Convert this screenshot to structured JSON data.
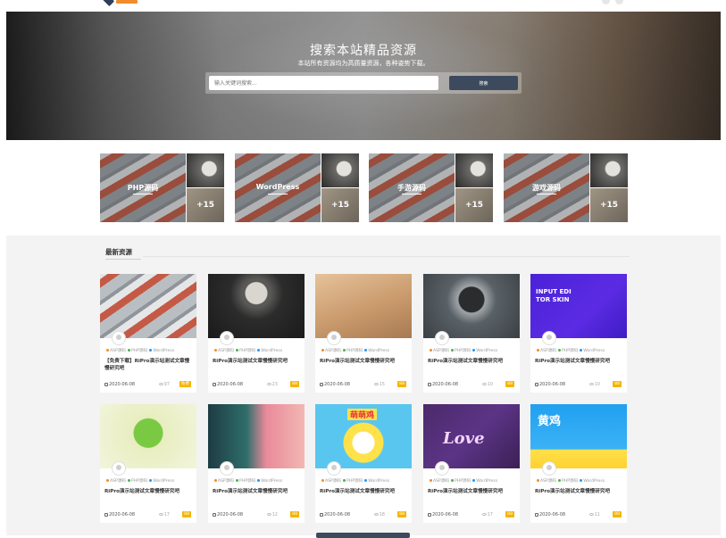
{
  "hero": {
    "title": "搜索本站精品资源",
    "subtitle": "本站所有资源均为高质量资源，各种姿势下载。",
    "search_placeholder": "输入关键词搜索...",
    "search_button": "搜索"
  },
  "categories": [
    {
      "label": "PHP源码",
      "count": "+15"
    },
    {
      "label": "WordPress",
      "count": "+15"
    },
    {
      "label": "手游源码",
      "count": "+15"
    },
    {
      "label": "游戏源码",
      "count": "+15"
    }
  ],
  "latest": {
    "title": "最新资源",
    "cards": [
      {
        "tags": [
          "ASP源码",
          "PHP源码",
          "WordPress"
        ],
        "title": "【免费下载】RiPro演示站测试文章慢慢研究吧",
        "date": "2020-06-08",
        "views": "97",
        "price": "免费"
      },
      {
        "tags": [
          "ASP源码",
          "PHP源码",
          "WordPress"
        ],
        "title": "RiPro演示站测试文章慢慢研究吧",
        "date": "2020-06-08",
        "views": "23",
        "price": "88"
      },
      {
        "tags": [
          "ASP源码",
          "PHP源码",
          "WordPress"
        ],
        "title": "RiPro演示站测试文章慢慢研究吧",
        "date": "2020-06-08",
        "views": "15",
        "price": "88"
      },
      {
        "tags": [
          "ASP源码",
          "PHP源码",
          "WordPress"
        ],
        "title": "RiPro演示站测试文章慢慢研究吧",
        "date": "2020-06-08",
        "views": "10",
        "price": "88"
      },
      {
        "tags": [
          "ASP源码",
          "PHP源码",
          "WordPress"
        ],
        "title": "RiPro演示站测试文章慢慢研究吧",
        "date": "2020-06-08",
        "views": "10",
        "price": "88"
      },
      {
        "tags": [
          "ASP源码",
          "PHP源码",
          "WordPress"
        ],
        "title": "RiPro演示站测试文章慢慢研究吧",
        "date": "2020-06-08",
        "views": "17",
        "price": "88"
      },
      {
        "tags": [
          "ASP源码",
          "PHP源码",
          "WordPress"
        ],
        "title": "RiPro演示站测试文章慢慢研究吧",
        "date": "2020-06-08",
        "views": "12",
        "price": "88"
      },
      {
        "tags": [
          "ASP源码",
          "PHP源码",
          "WordPress"
        ],
        "title": "RiPro演示站测试文章慢慢研究吧",
        "date": "2020-06-08",
        "views": "18",
        "price": "88"
      },
      {
        "tags": [
          "ASP源码",
          "PHP源码",
          "WordPress"
        ],
        "title": "RiPro演示站测试文章慢慢研究吧",
        "date": "2020-06-08",
        "views": "17",
        "price": "88"
      },
      {
        "tags": [
          "ASP源码",
          "PHP源码",
          "WordPress"
        ],
        "title": "RiPro演示站测试文章慢慢研究吧",
        "date": "2020-06-08",
        "views": "11",
        "price": "88"
      }
    ],
    "thumb_texts": {
      "card5": "INPUT EDI TOR SKIN",
      "card8": "萌萌鸡",
      "card9": "Love",
      "card10": "黄鸡"
    }
  },
  "colors": {
    "accent": "#3d4a5e",
    "price_badge": "#f5b400",
    "tag_dots": [
      "#f28c28",
      "#4caf50",
      "#2196f3"
    ]
  }
}
